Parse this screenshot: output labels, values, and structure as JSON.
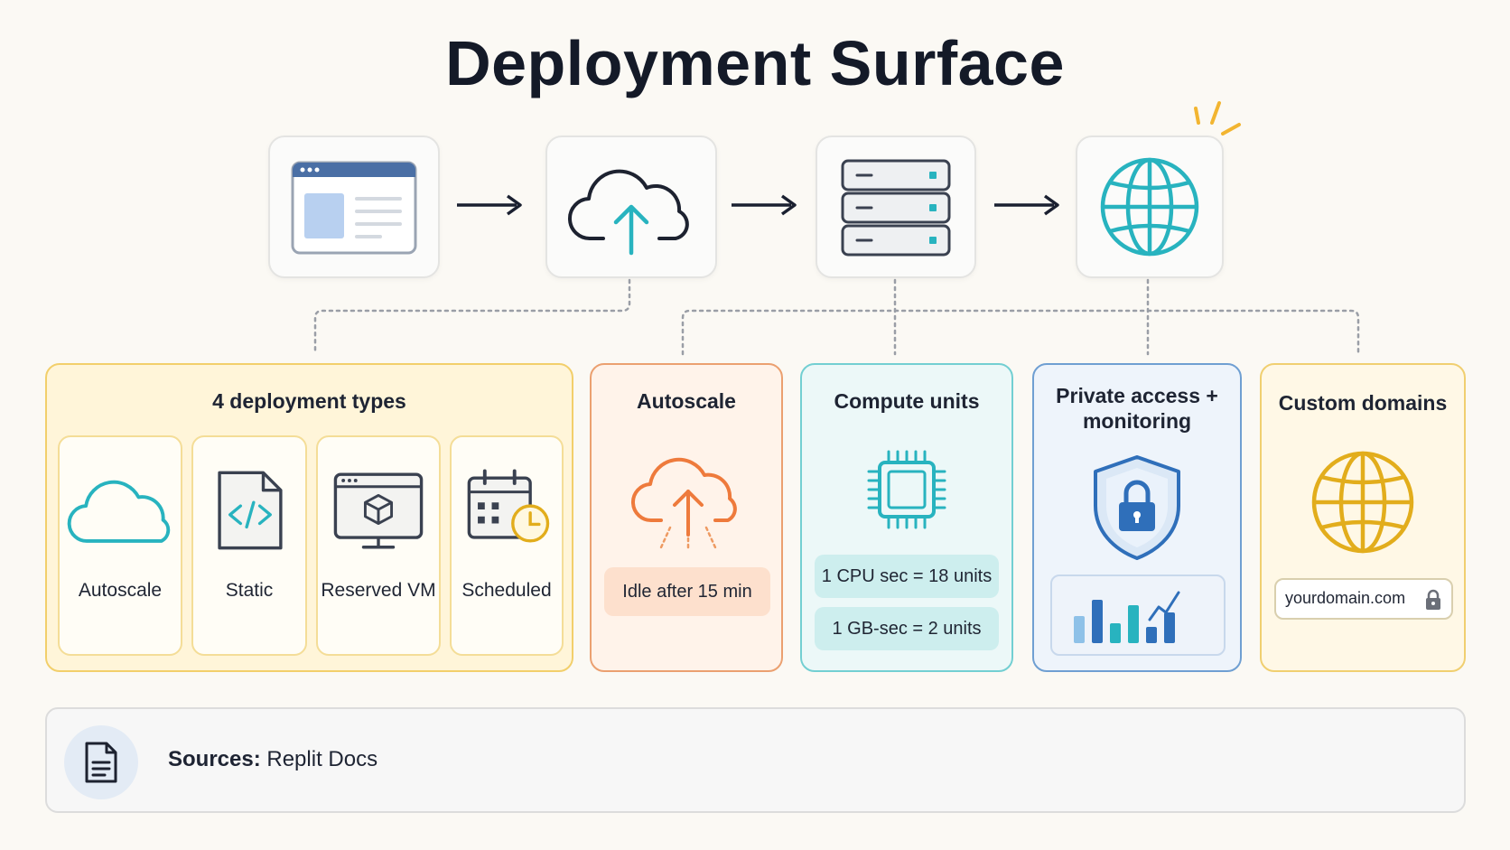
{
  "title": "Deployment Surface",
  "colors": {
    "accent_teal": "#28b3bf",
    "orange": "#ee7a3c",
    "yellow": "#e2ad1c",
    "blue": "#2f6fba",
    "dark": "#1d2230"
  },
  "flow_steps": [
    {
      "icon": "browser-window-icon"
    },
    {
      "icon": "cloud-upload-icon"
    },
    {
      "icon": "server-rack-icon"
    },
    {
      "icon": "globe-icon"
    }
  ],
  "deployment_types": {
    "title": "4 deployment types",
    "items": [
      {
        "label": "Autoscale",
        "icon": "cloud-icon"
      },
      {
        "label": "Static",
        "icon": "code-file-icon"
      },
      {
        "label": "Reserved VM",
        "icon": "vm-window-icon"
      },
      {
        "label": "Scheduled",
        "icon": "calendar-clock-icon"
      }
    ]
  },
  "autoscale": {
    "title": "Autoscale",
    "note": "Idle after 15 min"
  },
  "compute": {
    "title": "Compute units",
    "chips": [
      "1 CPU sec = 18 units",
      "1 GB-sec = 2 units"
    ]
  },
  "private": {
    "title_line1": "Private access +",
    "title_line2": "monitoring"
  },
  "domains": {
    "title": "Custom domains",
    "domain_value": "yourdomain.com"
  },
  "sources": {
    "label": "Sources:",
    "value": "Replit Docs"
  }
}
